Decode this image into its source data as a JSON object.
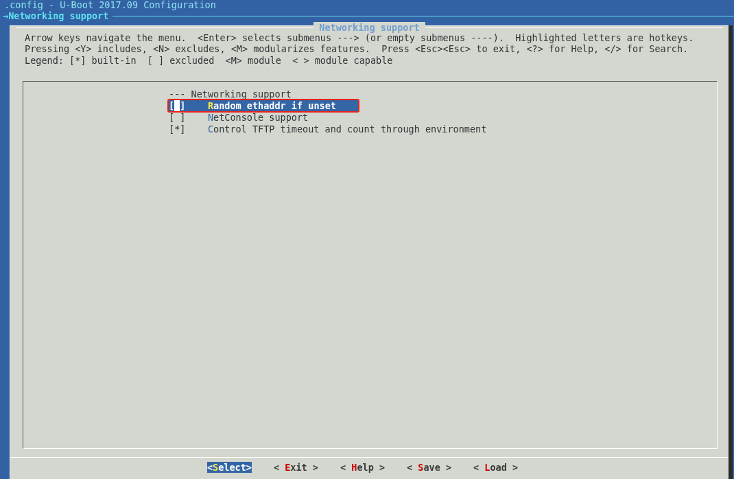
{
  "window": {
    "title": ".config - U-Boot 2017.09 Configuration",
    "breadcrumb": "→Networking support"
  },
  "dialog": {
    "title": "Networking support",
    "help": [
      "Arrow keys navigate the menu.  <Enter> selects submenus ---> (or empty submenus ----).  Highlighted letters are hotkeys.",
      "Pressing <Y> includes, <N> excludes, <M> modularizes features.  Press <Esc><Esc> to exit, <?> for Help, </> for Search.",
      "Legend: [*] built-in  [ ] excluded  <M> module  < > module capable"
    ],
    "items": [
      {
        "kind": "header",
        "label": "--- Networking support"
      },
      {
        "kind": "option",
        "marker": "[ ]",
        "label": "Random ethaddr if unset",
        "selected": true
      },
      {
        "kind": "option",
        "marker": "[ ]",
        "label": "NetConsole support",
        "selected": false
      },
      {
        "kind": "option",
        "marker": "[*]",
        "label": "Control TFTP timeout and count through environment",
        "selected": false
      }
    ],
    "buttons": [
      {
        "label": "<Select>",
        "selected": true
      },
      {
        "label": "< Exit >",
        "selected": false
      },
      {
        "label": "< Help >",
        "selected": false
      },
      {
        "label": "< Save >",
        "selected": false
      },
      {
        "label": "< Load >",
        "selected": false
      }
    ]
  }
}
